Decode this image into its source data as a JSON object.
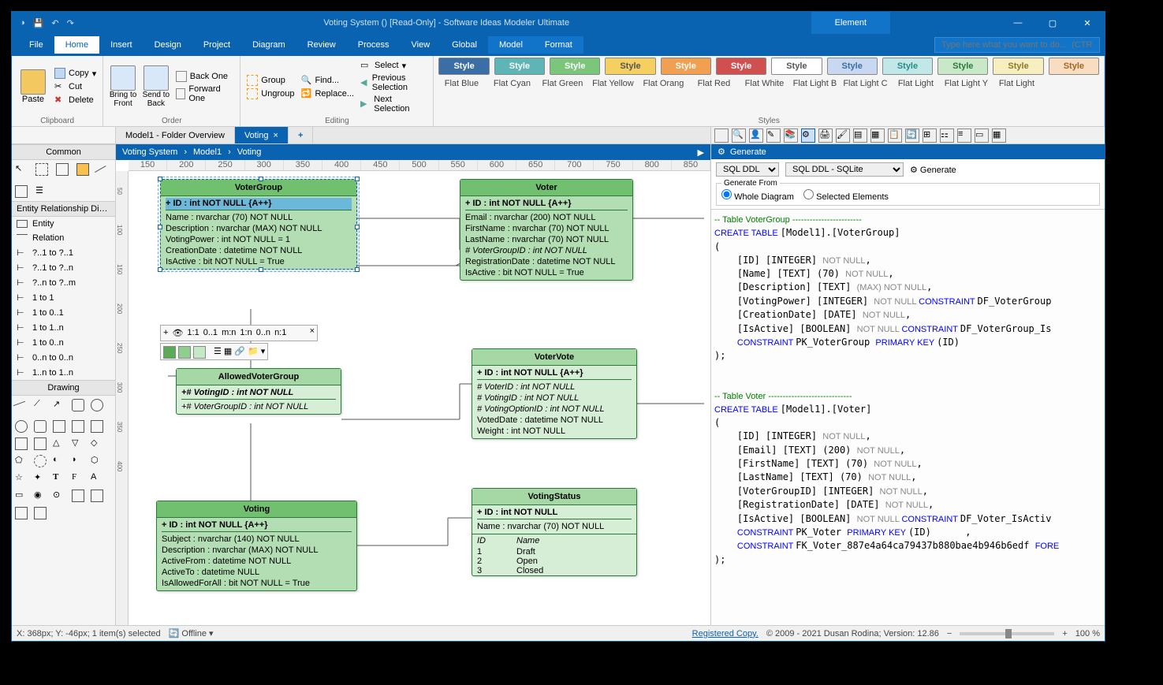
{
  "title": "Voting System () [Read-Only] - Software Ideas Modeler Ultimate",
  "context_tab": "Element",
  "win": {
    "min": "—",
    "max": "▢",
    "close": "✕"
  },
  "menu": {
    "items": [
      "File",
      "Home",
      "Insert",
      "Design",
      "Project",
      "Diagram",
      "Review",
      "Process",
      "View",
      "Global",
      "Model",
      "Format"
    ],
    "active": "Home",
    "search_ph": "Type here what you want to do...  (CTRL+Q)"
  },
  "ribbon": {
    "clipboard": {
      "label": "Clipboard",
      "paste": "Paste",
      "copy": "Copy",
      "cut": "Cut",
      "delete": "Delete"
    },
    "order": {
      "label": "Order",
      "bring_front": "Bring to\nFront",
      "send_back": "Send to\nBack",
      "back_one": "Back One",
      "fwd_one": "Forward One"
    },
    "editing": {
      "label": "Editing",
      "group": "Group",
      "ungroup": "Ungroup",
      "find": "Find...",
      "replace": "Replace...",
      "select": "Select",
      "prev_sel": "Previous Selection",
      "next_sel": "Next Selection"
    },
    "styles": {
      "label": "Styles",
      "boxes": [
        {
          "t": "Style",
          "bg": "#3a6ea5",
          "fg": "#fff"
        },
        {
          "t": "Style",
          "bg": "#5fb5b5",
          "fg": "#fff"
        },
        {
          "t": "Style",
          "bg": "#7cc67c",
          "fg": "#fff"
        },
        {
          "t": "Style",
          "bg": "#f5d060",
          "fg": "#555"
        },
        {
          "t": "Style",
          "bg": "#f0a050",
          "fg": "#fff"
        },
        {
          "t": "Style",
          "bg": "#d05050",
          "fg": "#fff"
        },
        {
          "t": "Style",
          "bg": "#ffffff",
          "fg": "#555"
        },
        {
          "t": "Style",
          "bg": "#c8d8f0",
          "fg": "#3a6ea5"
        },
        {
          "t": "Style",
          "bg": "#c0e8e8",
          "fg": "#2a8a8a"
        },
        {
          "t": "Style",
          "bg": "#c8e8c8",
          "fg": "#2a7a3a"
        },
        {
          "t": "Style",
          "bg": "#f8efc0",
          "fg": "#8a7a2a"
        },
        {
          "t": "Style",
          "bg": "#f8ddc0",
          "fg": "#a0652a"
        }
      ],
      "names": [
        "Flat Blue",
        "Flat Cyan",
        "Flat Green",
        "Flat Yellow",
        "Flat Orang",
        "Flat Red",
        "Flat White",
        "Flat Light B",
        "Flat Light C",
        "Flat Light",
        "Flat Light Y",
        "Flat Light"
      ]
    }
  },
  "left": {
    "common": "Common",
    "erd_header": "Entity Relationship Di…",
    "entity": "Entity",
    "relation": "Relation",
    "rels": [
      "?..1 to ?..1",
      "?..1 to ?..n",
      "?..n to ?..m",
      "1 to 1",
      "1 to 0..1",
      "1 to 1..n",
      "1 to 0..n",
      "0..n to 0..n",
      "1..n to 1..n"
    ],
    "drawing": "Drawing"
  },
  "tabs": {
    "t1": "Model1 - Folder Overview",
    "t2": "Voting"
  },
  "breadcrumb": [
    "Voting System",
    "Model1",
    "Voting"
  ],
  "ruler_h": [
    "150",
    "200",
    "250",
    "300",
    "350",
    "400",
    "450",
    "500",
    "550",
    "600",
    "650",
    "700",
    "750",
    "800",
    "850"
  ],
  "ruler_v": [
    "50",
    "100",
    "150",
    "200",
    "250",
    "300",
    "350",
    "400"
  ],
  "entities": {
    "voterGroup": {
      "name": "VoterGroup",
      "attrs": [
        "+ ID : int NOT NULL  {A++}",
        "Name : nvarchar (70)  NOT NULL",
        "Description : nvarchar (MAX)  NOT NULL",
        "VotingPower : int NOT NULL = 1",
        "CreationDate : datetime NOT NULL",
        "IsActive : bit NOT NULL = True"
      ]
    },
    "voter": {
      "name": "Voter",
      "attrs": [
        "+ ID : int NOT NULL  {A++}",
        "Email : nvarchar (200)  NOT NULL",
        "FirstName : nvarchar (70)  NOT NULL",
        "LastName : nvarchar (70)  NOT NULL",
        "# VoterGroupID : int NOT NULL",
        "RegistrationDate : datetime NOT NULL",
        "IsActive : bit NOT NULL = True"
      ]
    },
    "allowedVG": {
      "name": "AllowedVoterGroup",
      "attrs": [
        "+# VotingID : int NOT NULL",
        "+# VoterGroupID : int NOT NULL"
      ]
    },
    "voterVote": {
      "name": "VoterVote",
      "attrs": [
        "+ ID : int NOT NULL  {A++}",
        "# VoterID : int NOT NULL",
        "# VotingID : int NOT NULL",
        "# VotingOptionID : int NOT NULL",
        "VotedDate : datetime NOT NULL",
        "Weight : int NOT NULL"
      ]
    },
    "voting": {
      "name": "Voting",
      "attrs": [
        "+ ID : int NOT NULL  {A++}",
        "Subject : nvarchar (140)  NOT NULL",
        "Description : nvarchar (MAX)  NOT NULL",
        "ActiveFrom : datetime NOT NULL",
        "ActiveTo : datetime NULL",
        "IsAllowedForAll : bit NOT NULL = True"
      ]
    },
    "votingStatus": {
      "name": "VotingStatus",
      "attrs": [
        "+ ID : int NOT NULL",
        "Name : nvarchar (70)  NOT NULL"
      ],
      "cols": [
        "ID",
        "Name"
      ],
      "rows": [
        [
          "1",
          "Draft"
        ],
        [
          "2",
          "Open"
        ],
        [
          "3",
          "Closed"
        ]
      ]
    }
  },
  "ctx_tb": {
    "items": [
      "+",
      "👁",
      "1:1",
      "0..1",
      "m:n",
      "1:n",
      "0..n",
      "n:1"
    ],
    "close": "×"
  },
  "gen": {
    "title": "Generate",
    "lang": "SQL DDL",
    "dialect": "SQL DDL - SQLite",
    "btn": "Generate",
    "from_label": "Generate From",
    "opt_whole": "Whole Diagram",
    "opt_sel": "Selected Elements"
  },
  "sql": [
    [
      "comment",
      "-- Table VoterGroup ------------------------"
    ],
    [
      "kw",
      "CREATE TABLE ",
      "plain",
      "[Model1].[VoterGroup]"
    ],
    [
      "plain",
      "("
    ],
    [
      "indent",
      "    [ID] [INTEGER] ",
      "gray",
      "NOT NULL",
      "plain",
      ","
    ],
    [
      "indent",
      "    [Name] [TEXT] (70) ",
      "gray",
      "NOT NULL",
      "plain",
      ","
    ],
    [
      "indent",
      "    [Description] [TEXT] ",
      "gray",
      "(MAX) ",
      "gray2",
      "NOT NULL",
      "plain",
      ","
    ],
    [
      "indent",
      "    [VotingPower] [INTEGER] ",
      "gray",
      "NOT NULL ",
      "kw",
      "CONSTRAINT ",
      "plain",
      "DF_VoterGroup"
    ],
    [
      "indent",
      "    [CreationDate] [DATE] ",
      "gray",
      "NOT NULL",
      "plain",
      ","
    ],
    [
      "indent",
      "    [IsActive] [BOOLEAN] ",
      "gray",
      "NOT NULL ",
      "kw",
      "CONSTRAINT ",
      "plain",
      "DF_VoterGroup_Is"
    ],
    [
      "indent",
      "    ",
      "kw",
      "CONSTRAINT ",
      "plain",
      "PK_VoterGroup ",
      "kw",
      "PRIMARY KEY ",
      "plain",
      "(ID)"
    ],
    [
      "plain",
      ");"
    ],
    [
      "blank",
      ""
    ],
    [
      "blank",
      ""
    ],
    [
      "comment",
      "-- Table Voter -----------------------------"
    ],
    [
      "kw",
      "CREATE TABLE ",
      "plain",
      "[Model1].[Voter]"
    ],
    [
      "plain",
      "("
    ],
    [
      "indent",
      "    [ID] [INTEGER] ",
      "gray",
      "NOT NULL",
      "plain",
      ","
    ],
    [
      "indent",
      "    [Email] [TEXT] (200) ",
      "gray",
      "NOT NULL",
      "plain",
      ","
    ],
    [
      "indent",
      "    [FirstName] [TEXT] (70) ",
      "gray",
      "NOT NULL",
      "plain",
      ","
    ],
    [
      "indent",
      "    [LastName] [TEXT] (70) ",
      "gray",
      "NOT NULL",
      "plain",
      ","
    ],
    [
      "indent",
      "    [VoterGroupID] [INTEGER] ",
      "gray",
      "NOT NULL",
      "plain",
      ","
    ],
    [
      "indent",
      "    [RegistrationDate] [DATE] ",
      "gray",
      "NOT NULL",
      "plain",
      ","
    ],
    [
      "indent",
      "    [IsActive] [BOOLEAN] ",
      "gray",
      "NOT NULL ",
      "kw",
      "CONSTRAINT ",
      "plain",
      "DF_Voter_IsActiv"
    ],
    [
      "indent",
      "    ",
      "kw",
      "CONSTRAINT ",
      "plain",
      "PK_Voter ",
      "kw",
      "PRIMARY KEY ",
      "plain",
      "(ID)      ,"
    ],
    [
      "indent",
      "    ",
      "kw",
      "CONSTRAINT ",
      "plain",
      "FK_Voter_887e4a64ca79437b880bae4b946b6edf ",
      "kw",
      "FORE"
    ],
    [
      "plain",
      ");"
    ]
  ],
  "status": {
    "pos": "X: 368px; Y: -46px; 1 item(s) selected",
    "offline": "Offline",
    "reg": "Registered Copy.",
    "copy": "© 2009 - 2021 Dusan Rodina; Version: 12.86",
    "zoom": "100 %"
  }
}
